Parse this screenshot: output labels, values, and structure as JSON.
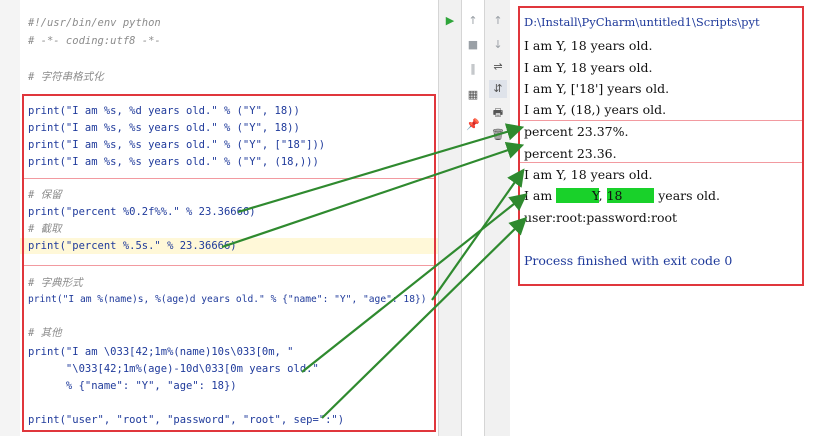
{
  "editor": {
    "lines": [
      {
        "text": "#!/usr/bin/env python",
        "kind": "comment"
      },
      {
        "text": "# -*- coding:utf8 -*-",
        "kind": "comment"
      },
      {
        "text": "# 字符串格式化",
        "kind": "comment"
      },
      {
        "text": "print(\"I am %s, %d years old.\" % (\"Y\", 18))",
        "kind": "code"
      },
      {
        "text": "print(\"I am %s, %s years old.\" % (\"Y\", 18))",
        "kind": "code"
      },
      {
        "text": "print(\"I am %s, %s years old.\" % (\"Y\", [\"18\"]))",
        "kind": "code"
      },
      {
        "text": "print(\"I am %s, %s years old.\" % (\"Y\", (18,)))",
        "kind": "code"
      },
      {
        "text": "# 保留",
        "kind": "comment"
      },
      {
        "text": "print(\"percent %0.2f%%.\" % 23.36666)",
        "kind": "code"
      },
      {
        "text": "# 截取",
        "kind": "comment"
      },
      {
        "text": "print(\"percent %.5s.\" % 23.36666)",
        "kind": "code"
      },
      {
        "text": "# 字典形式",
        "kind": "comment"
      },
      {
        "text": "print(\"I am %(name)s, %(age)d years old.\" % {\"name\": \"Y\", \"age\": 18})",
        "kind": "code"
      },
      {
        "text": "# 其他",
        "kind": "comment"
      },
      {
        "text": "print(\"I am \\033[42;1m%(name)10s\\033[0m, \"",
        "kind": "code"
      },
      {
        "text": "      \"\\033[42;1m%(age)-10d\\033[0m years old.\"",
        "kind": "code"
      },
      {
        "text": "      % {\"name\": \"Y\", \"age\": 18})",
        "kind": "code"
      },
      {
        "text": "print(\"user\", \"root\", \"password\", \"root\", sep=\":\")",
        "kind": "code"
      }
    ]
  },
  "run_toolbar": {
    "run": "▶",
    "up": "↑",
    "stop": "■",
    "down": "↓",
    "pause": "‖",
    "wrap": "⇌",
    "layout": "▦",
    "sort": "⇵",
    "pin": "📌",
    "print": "🖶",
    "delete": "🗑"
  },
  "console": {
    "path": "D:\\Install\\PyCharm\\untitled1\\Scripts\\pyt",
    "out1": "I am Y, 18 years old.",
    "out2": "I am Y, 18 years old.",
    "out3": "I am Y, ['18'] years old.",
    "out4": "I am Y, (18,) years old.",
    "out5": "percent 23.37%.",
    "out6": "percent 23.36.",
    "out7": "I am Y, 18 years old.",
    "out8_prefix": "I am ",
    "out8_name": "         Y",
    "out8_mid": ", ",
    "out8_age": "18        ",
    "out8_suffix": " years old.",
    "out9": "user:root:password:root",
    "done": "Process finished with exit code 0"
  },
  "colors": {
    "highlight": "#19d12a",
    "box": "#e0363c",
    "arrow": "#2f8a2f"
  }
}
